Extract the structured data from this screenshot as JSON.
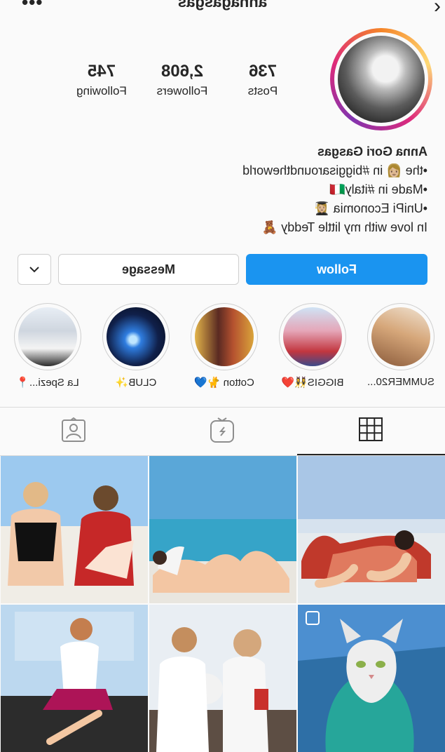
{
  "header": {
    "username": "annagasgas",
    "back_icon": "chevron-left-icon",
    "more_icon": "more-dots-icon"
  },
  "profile": {
    "stats": [
      {
        "value": "736",
        "label": "Posts"
      },
      {
        "value": "2,608",
        "label": "Followers"
      },
      {
        "value": "745",
        "label": "Following"
      }
    ],
    "name": "Anna Gori Gasgas",
    "bio_lines": [
      "•the 👩🏼 in #biggisaroundtheworld",
      "•Made in #italy🇮🇹",
      "•UniPi Economia 👩🏼‍🎓",
      "In love with my little Teddy 🧸"
    ]
  },
  "actions": {
    "follow": "Follow",
    "message": "Message",
    "more": "⌄"
  },
  "highlights": [
    {
      "label": "SUMMER20..."
    },
    {
      "label": "BIGGIS👯‍♀️❤️"
    },
    {
      "label": "Cotton 🐈💙"
    },
    {
      "label": "CLUB✨"
    },
    {
      "label": "La Spezi...📍"
    }
  ],
  "tabs": [
    {
      "name": "grid",
      "icon": "grid-icon"
    },
    {
      "name": "igtv",
      "icon": "igtv-icon"
    },
    {
      "name": "tagged",
      "icon": "tagged-user-icon"
    }
  ],
  "colors": {
    "follow_button": "#1a94f0",
    "active_tab_underline": "#262626"
  }
}
